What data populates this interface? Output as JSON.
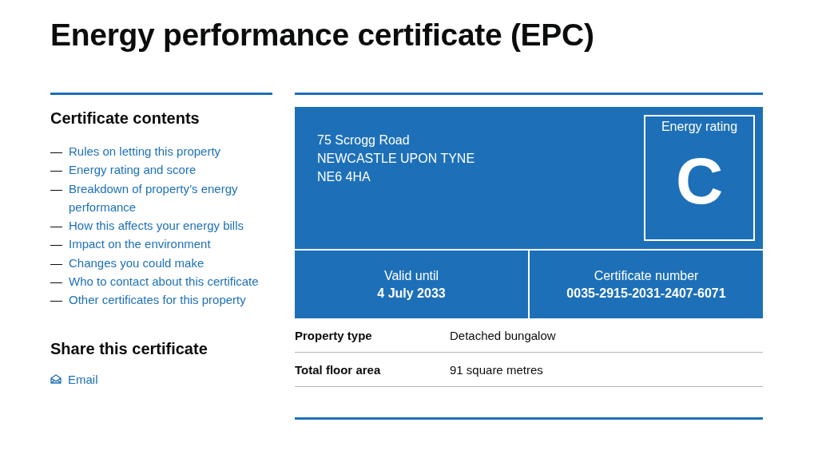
{
  "title": "Energy performance certificate (EPC)",
  "contents": {
    "heading": "Certificate contents",
    "items": [
      {
        "marker": "—",
        "label": "Rules on letting this property"
      },
      {
        "marker": "—",
        "label": "Energy rating and score"
      },
      {
        "marker": "—",
        "label": "Breakdown of property’s energy performance"
      },
      {
        "marker": "—",
        "label": "How this affects your energy bills"
      },
      {
        "marker": "—",
        "label": "Impact on the environment"
      },
      {
        "marker": "—",
        "label": "Changes you could make"
      },
      {
        "marker": "—",
        "label": "Who to contact about this certificate"
      },
      {
        "marker": "—",
        "label": "Other certificates for this property"
      }
    ]
  },
  "share": {
    "heading": "Share this certificate",
    "links": [
      {
        "label": "Email"
      }
    ]
  },
  "certificate": {
    "address": [
      "75 Scrogg Road",
      "NEWCASTLE UPON TYNE",
      "NE6 4HA"
    ],
    "rating": {
      "label": "Energy rating",
      "grade": "C"
    },
    "facts": [
      {
        "label": "Valid until",
        "value": "4 July 2033"
      },
      {
        "label": "Certificate number",
        "value": "0035-2915-2031-2407-6071"
      }
    ]
  },
  "summary": [
    {
      "label": "Property type",
      "value": "Detached bungalow"
    },
    {
      "label": "Total floor area",
      "value": "91 square metres"
    }
  ]
}
